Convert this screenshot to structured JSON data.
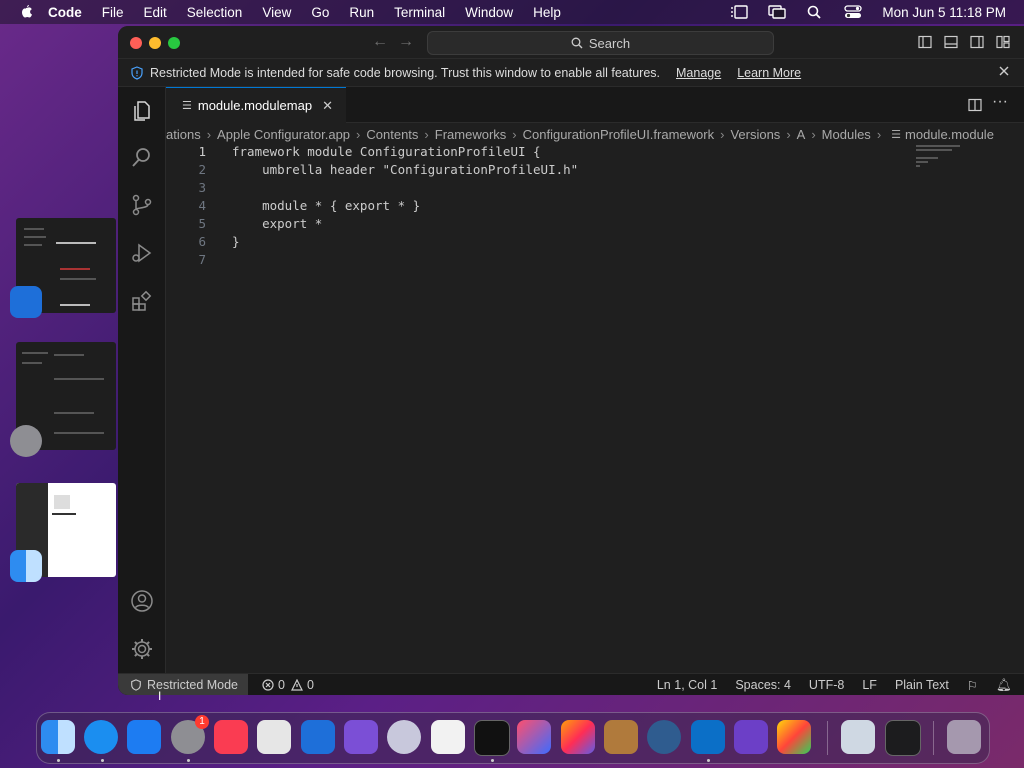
{
  "menubar": {
    "app": "Code",
    "items": [
      "File",
      "Edit",
      "Selection",
      "View",
      "Go",
      "Run",
      "Terminal",
      "Window",
      "Help"
    ],
    "clock": "Mon Jun 5  11:18 PM"
  },
  "window": {
    "search_label": "Search",
    "banner": {
      "text": "Restricted Mode is intended for safe code browsing. Trust this window to enable all features.",
      "manage": "Manage",
      "learn_more": "Learn More"
    },
    "tab": {
      "label": "module.modulemap"
    },
    "breadcrumb": [
      "ations",
      "Apple Configurator.app",
      "Contents",
      "Frameworks",
      "ConfigurationProfileUI.framework",
      "Versions",
      "A",
      "Modules",
      "module.module"
    ],
    "code": [
      {
        "n": "1",
        "text": "framework module ConfigurationProfileUI {"
      },
      {
        "n": "2",
        "text": "    umbrella header \"ConfigurationProfileUI.h\""
      },
      {
        "n": "3",
        "text": ""
      },
      {
        "n": "4",
        "text": "    module * { export * }"
      },
      {
        "n": "5",
        "text": "    export *"
      },
      {
        "n": "6",
        "text": "}"
      },
      {
        "n": "7",
        "text": ""
      }
    ],
    "status": {
      "restricted": "Restricted Mode",
      "errors": "0",
      "warnings": "0",
      "position": "Ln 1, Col 1",
      "spaces": "Spaces: 4",
      "encoding": "UTF-8",
      "eol": "LF",
      "language": "Plain Text"
    }
  },
  "dock": {
    "badge": "1"
  },
  "colors": {
    "accent": "#0078d4",
    "close": "#ff5f57",
    "minimize": "#febc2e",
    "zoom": "#28c840"
  }
}
